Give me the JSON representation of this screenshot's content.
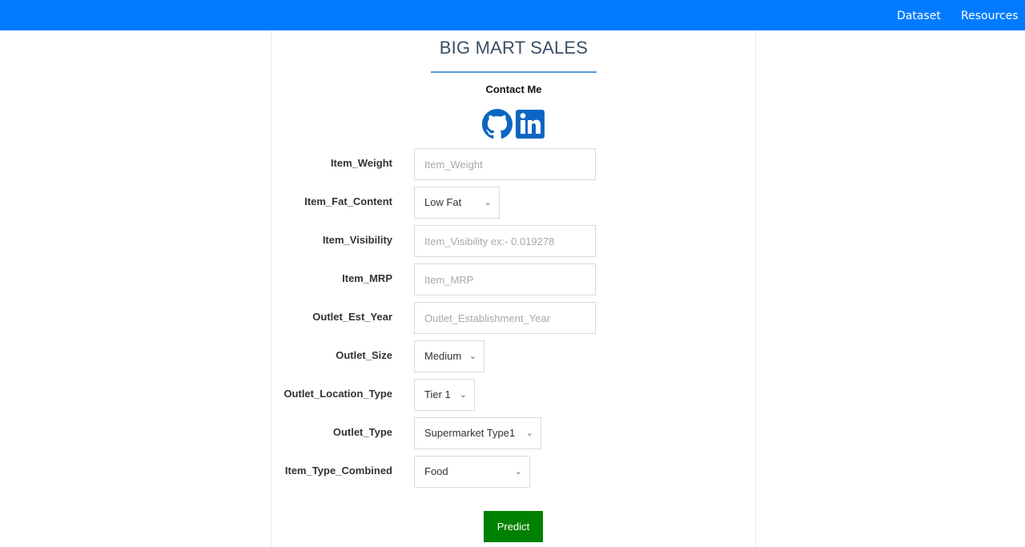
{
  "nav": {
    "links": [
      "Dataset",
      "Resources"
    ],
    "bar_color": "#007bff"
  },
  "header": {
    "title": "BIG MART SALES",
    "contact_label": "Contact Me",
    "social_icons": [
      "github-icon",
      "linkedin-icon"
    ],
    "social_color": "#0a66c2"
  },
  "form": {
    "fields": [
      {
        "label": "Item_Weight",
        "type": "input",
        "value": "",
        "placeholder": "Item_Weight"
      },
      {
        "label": "Item_Fat_Content",
        "type": "select",
        "value": "Low Fat"
      },
      {
        "label": "Item_Visibility",
        "type": "input",
        "value": "",
        "placeholder": "Item_Visibility ex:- 0.019278"
      },
      {
        "label": "Item_MRP",
        "type": "input",
        "value": "",
        "placeholder": "Item_MRP"
      },
      {
        "label": "Outlet_Est_Year",
        "type": "input",
        "value": "",
        "placeholder": "Outlet_Establishment_Year"
      },
      {
        "label": "Outlet_Size",
        "type": "select",
        "value": "Medium"
      },
      {
        "label": "Outlet_Location_Type",
        "type": "select",
        "value": "Tier 1"
      },
      {
        "label": "Outlet_Type",
        "type": "select",
        "value": "Supermarket Type1"
      },
      {
        "label": "Item_Type_Combined",
        "type": "select",
        "value": "Food"
      }
    ],
    "submit_label": "Predict",
    "submit_color": "#008000"
  }
}
